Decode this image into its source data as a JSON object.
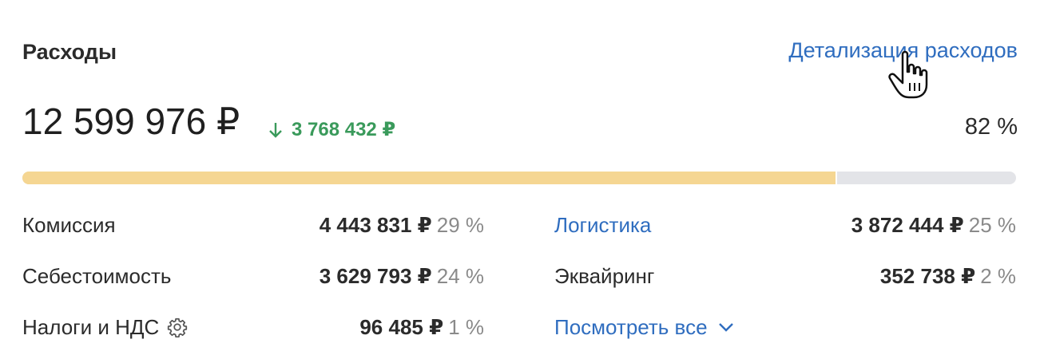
{
  "header": {
    "title": "Расходы",
    "details_link": "Детализация расходов"
  },
  "summary": {
    "total": "12 599 976 ₽",
    "delta": "3 768 432 ₽",
    "delta_direction": "down",
    "share_percent_label": "82 %",
    "progress_fraction": 0.82
  },
  "breakdown": {
    "left": [
      {
        "label": "Комиссия",
        "value": "4 443 831 ₽",
        "pct": "29 %"
      },
      {
        "label": "Себестоимость",
        "value": "3 629 793 ₽",
        "pct": "24 %"
      },
      {
        "label": "Налоги и НДС",
        "value": "96 485 ₽",
        "pct": "1 %",
        "icon": "gear-icon"
      }
    ],
    "right": [
      {
        "label": "Логистика",
        "value": "3 872 444 ₽",
        "pct": "25 %",
        "link": true
      },
      {
        "label": "Эквайринг",
        "value": "352 738 ₽",
        "pct": "2 %"
      }
    ],
    "show_all": "Посмотреть все"
  },
  "colors": {
    "link": "#2f6dbf",
    "positive": "#3a9a5b",
    "bar_fill": "#f5d692",
    "bar_track": "#e3e4e8"
  }
}
